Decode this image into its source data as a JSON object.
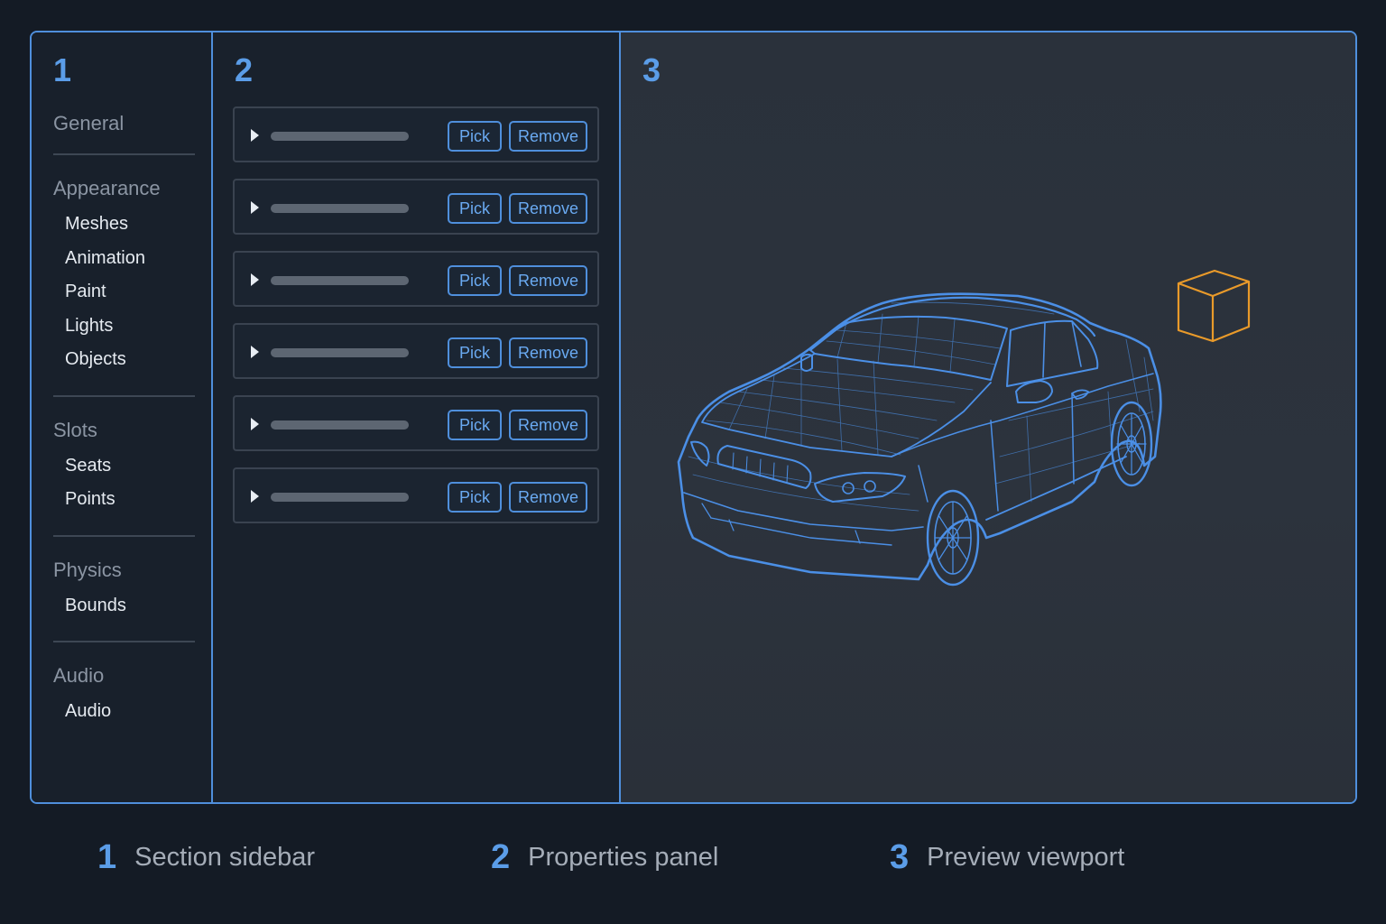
{
  "columns": {
    "sidebar_number": "1",
    "properties_number": "2",
    "viewport_number": "3"
  },
  "sidebar": {
    "groups": [
      {
        "title": "General",
        "items": []
      },
      {
        "title": "Appearance",
        "items": [
          "Meshes",
          "Animation",
          "Paint",
          "Lights",
          "Objects"
        ]
      },
      {
        "title": "Slots",
        "items": [
          "Seats",
          "Points"
        ]
      },
      {
        "title": "Physics",
        "items": [
          "Bounds"
        ]
      },
      {
        "title": "Audio",
        "items": [
          "Audio"
        ]
      }
    ]
  },
  "properties": {
    "rows": [
      {
        "pick": "Pick",
        "remove": "Remove"
      },
      {
        "pick": "Pick",
        "remove": "Remove"
      },
      {
        "pick": "Pick",
        "remove": "Remove"
      },
      {
        "pick": "Pick",
        "remove": "Remove"
      },
      {
        "pick": "Pick",
        "remove": "Remove"
      },
      {
        "pick": "Pick",
        "remove": "Remove"
      }
    ]
  },
  "viewport": {
    "model_icon": "car-wireframe-icon",
    "gizmo_icon": "cube-icon",
    "wire_color": "#4b8fe6",
    "gizmo_color": "#e99a2a"
  },
  "legend": [
    {
      "number": "1",
      "label": "Section sidebar"
    },
    {
      "number": "2",
      "label": "Properties panel"
    },
    {
      "number": "3",
      "label": "Preview viewport"
    }
  ],
  "colors": {
    "accent": "#4f8fdc",
    "background": "#141b25"
  }
}
